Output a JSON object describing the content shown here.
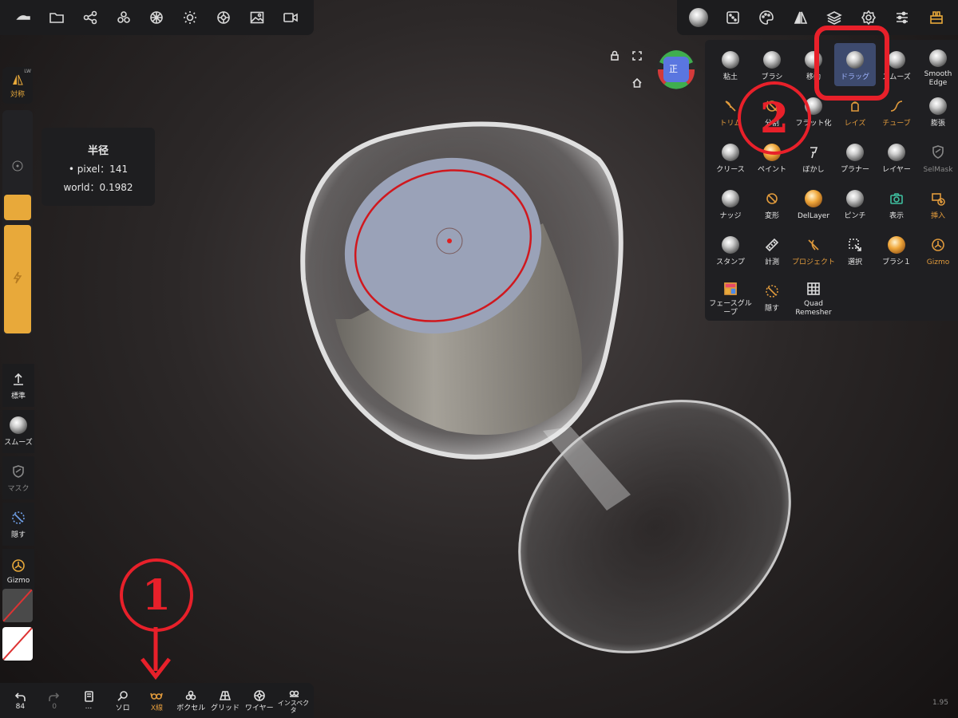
{
  "top_left_toolbar": {
    "icons": [
      "hide-left-panel-icon",
      "folder-icon",
      "share-icon",
      "scene-icon",
      "material-ball-icon",
      "light-icon",
      "render-icon",
      "image-icon",
      "video-icon"
    ]
  },
  "top_right_toolbar": {
    "icons": [
      "tool-sphere-icon",
      "dice-icon",
      "palette-icon",
      "symmetry-icon",
      "layers-icon",
      "settings-icon",
      "sliders-icon",
      "app-menu-icon"
    ]
  },
  "tools": [
    {
      "label": "粘土",
      "icon": "sphere"
    },
    {
      "label": "ブラシ",
      "icon": "sphere"
    },
    {
      "label": "移動",
      "icon": "sphere"
    },
    {
      "label": "ドラッグ",
      "icon": "sphere",
      "active": true
    },
    {
      "label": "スムーズ",
      "icon": "sphere"
    },
    {
      "label": "Smooth Edge",
      "icon": "sphere"
    },
    {
      "label": "トリム",
      "icon": "trim"
    },
    {
      "label": "分割",
      "icon": "split"
    },
    {
      "label": "フラット化",
      "icon": "sphere"
    },
    {
      "label": "レイズ",
      "icon": "raise"
    },
    {
      "label": "チューブ",
      "icon": "tube"
    },
    {
      "label": "膨張",
      "icon": "sphere"
    },
    {
      "label": "クリース",
      "icon": "sphere"
    },
    {
      "label": "ペイント",
      "icon": "sphere-orange"
    },
    {
      "label": "ぼかし",
      "icon": "smudge"
    },
    {
      "label": "プラナー",
      "icon": "sphere"
    },
    {
      "label": "レイヤー",
      "icon": "sphere"
    },
    {
      "label": "SelMask",
      "icon": "shield"
    },
    {
      "label": "ナッジ",
      "icon": "sphere"
    },
    {
      "label": "変形",
      "icon": "transform"
    },
    {
      "label": "DelLayer",
      "icon": "sphere-orange"
    },
    {
      "label": "ピンチ",
      "icon": "sphere"
    },
    {
      "label": "表示",
      "icon": "camera"
    },
    {
      "label": "挿入",
      "icon": "insert"
    },
    {
      "label": "スタンプ",
      "icon": "sphere"
    },
    {
      "label": "計測",
      "icon": "ruler"
    },
    {
      "label": "プロジェクト",
      "icon": "project"
    },
    {
      "label": "選択",
      "icon": "select"
    },
    {
      "label": "ブラシ１",
      "icon": "sphere-orange"
    },
    {
      "label": "Gizmo",
      "icon": "gizmo"
    },
    {
      "label": "フェースグループ",
      "icon": "facegroup"
    },
    {
      "label": "隠す",
      "icon": "hide"
    },
    {
      "label": "Quad Remesher",
      "icon": "grid"
    }
  ],
  "left": {
    "symmetry_label": "対称",
    "symmetry_badge": "LW",
    "radius_tooltip": {
      "title": "半径",
      "pixel": "• pixel：141",
      "world": "world：0.1982"
    },
    "tools": [
      {
        "label": "標準",
        "icon": "upload-icon"
      },
      {
        "label": "スムーズ",
        "icon": "smooth-sphere-icon"
      },
      {
        "label": "マスク",
        "icon": "mask-icon",
        "dim": true
      },
      {
        "label": "隠す",
        "icon": "hide-icon"
      },
      {
        "label": "Gizmo",
        "icon": "gizmo-icon"
      }
    ]
  },
  "cube_label": "正",
  "bottom": [
    {
      "label": "84",
      "icon": "undo-icon"
    },
    {
      "label": "0",
      "icon": "redo-icon",
      "dim": true
    },
    {
      "label": "...",
      "icon": "book-icon"
    },
    {
      "label": "ソロ",
      "icon": "search-icon"
    },
    {
      "label": "X線",
      "icon": "xray-glasses-icon",
      "active": true
    },
    {
      "label": "ボクセル",
      "icon": "voxel-icon"
    },
    {
      "label": "グリッド",
      "icon": "grid-icon"
    },
    {
      "label": "ワイヤー",
      "icon": "wireframe-icon"
    },
    {
      "label": "インスペクタ",
      "icon": "inspector-icon"
    }
  ],
  "version": "1.95",
  "annotations": {
    "one": "1",
    "two": "2"
  },
  "colors": {
    "accent": "#e8a93a",
    "annotation": "#e8202a",
    "active_tool": "#3d4a6e"
  }
}
